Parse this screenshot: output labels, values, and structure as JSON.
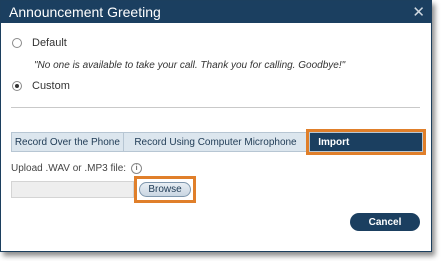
{
  "dialog": {
    "title": "Announcement Greeting",
    "close_glyph": "✕"
  },
  "greeting": {
    "options": [
      {
        "label": "Default",
        "checked": false
      },
      {
        "label": "Custom",
        "checked": true
      }
    ],
    "default_message": "\"No one is available to take your call. Thank you for calling. Goodbye!\""
  },
  "tabs": [
    {
      "label": "Record Over the Phone",
      "active": false
    },
    {
      "label": "Record Using Computer Microphone",
      "active": false
    },
    {
      "label": "Import",
      "active": true
    }
  ],
  "upload": {
    "label": "Upload .WAV or .MP3 file:",
    "info_glyph": "i",
    "file_value": "",
    "browse_label": "Browse"
  },
  "footer": {
    "cancel_label": "Cancel"
  },
  "colors": {
    "titlebar": "#1b3f60",
    "highlight": "#e07f2a"
  }
}
